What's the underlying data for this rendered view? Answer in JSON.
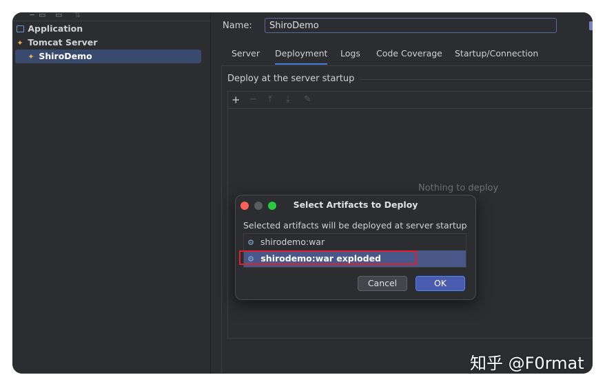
{
  "tree": {
    "items": [
      {
        "label": "Application",
        "icon": "application-icon"
      },
      {
        "label": "Tomcat Server",
        "icon": "tomcat-icon"
      },
      {
        "label": "ShiroDemo",
        "icon": "tomcat-config-icon",
        "selected": true
      }
    ]
  },
  "config": {
    "name_label": "Name:",
    "name_value": "ShiroDemo",
    "tabs": [
      {
        "label": "Server"
      },
      {
        "label": "Deployment",
        "active": true
      },
      {
        "label": "Logs"
      },
      {
        "label": "Code Coverage"
      },
      {
        "label": "Startup/Connection"
      }
    ],
    "section_title": "Deploy at the server startup",
    "toolbar": {
      "add": "+",
      "remove": "−",
      "move_up": "⤒",
      "move_down": "⤓",
      "edit": "✎"
    },
    "empty_text": "Nothing to deploy"
  },
  "dialog": {
    "title": "Select Artifacts to Deploy",
    "description": "Selected artifacts will be deployed at server startup",
    "artifacts": [
      {
        "label": "shirodemo:war",
        "selected": false
      },
      {
        "label": "shirodemo:war exploded",
        "selected": true
      }
    ],
    "cancel_label": "Cancel",
    "ok_label": "OK"
  },
  "colors": {
    "close": "#ff5f57",
    "minimize": "#5a5c60",
    "zoom": "#28c840",
    "highlight": "#e0202a",
    "selection": "#4a5789"
  },
  "watermark": "知乎 @F0rmat"
}
